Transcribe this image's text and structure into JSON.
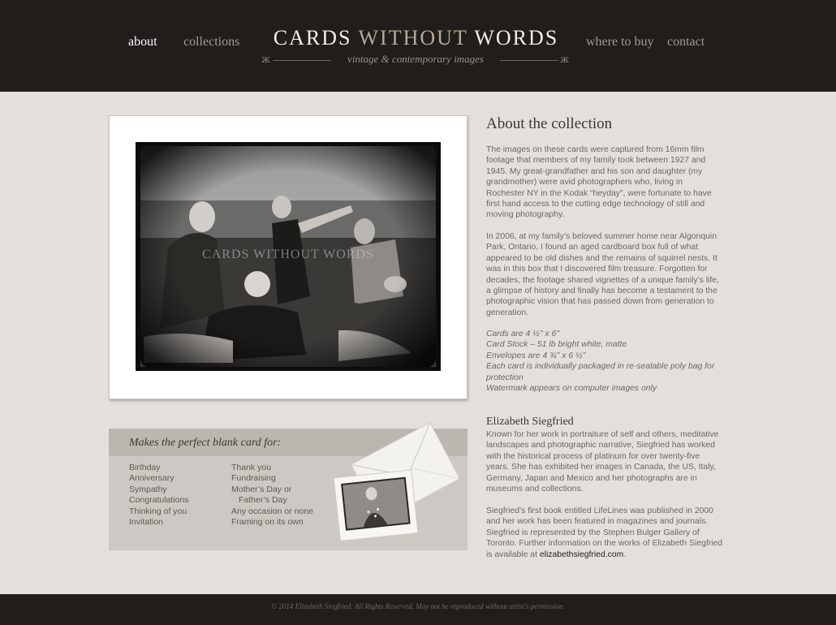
{
  "nav": {
    "about": "about",
    "collections": "collections",
    "where_to_buy": "where to buy",
    "contact": "contact"
  },
  "logo": {
    "title_part1": "CARDS ",
    "title_part2": "WITHOUT",
    "title_part3": " WORDS",
    "tagline": "vintage & contemporary images"
  },
  "photo": {
    "watermark": "CARDS WITHOUT WORDS"
  },
  "cards_box": {
    "title": "Makes the perfect blank card for:",
    "col1": [
      "Birthday",
      "Anniversary",
      "Sympathy",
      "Congratulations",
      "Thinking of you",
      "Invitation"
    ],
    "col2": [
      "Thank you",
      "Fundraising",
      "Mother’s Day or",
      "   Father’s Day",
      "Any occasion or none",
      "Framing on its own"
    ]
  },
  "about": {
    "heading": "About the collection",
    "para1": "The images on these cards were captured from 16mm film footage that members of my family took between 1927 and 1945. My great-grandfather and his son and daughter (my grandmother) were avid photographers who, living in Rochester NY in the Kodak “heyday”, were fortunate to have first hand access to the cutting edge technology of still and moving photography.",
    "para2": "In 2006, at my family’s beloved summer home near Algonquin Park, Ontario, I found an aged cardboard box full of what appeared to be old dishes and the remains of squirrel nests. It was in this box that I discovered film treasure. Forgotten for decades, the footage shared vignettes of a unique family’s life, a glimpse of history and finally has become a testament to the photographic vision that has passed down from generation to generation.",
    "specs": [
      "Cards are 4 ½\" x 6\"",
      "Card Stock – 51 lb bright white, matte",
      "Envelopes are 4 ¾\" x 6 ½\"",
      "Each card is individually packaged in re-sealable poly bag for protection",
      "Watermark appears on computer images only"
    ]
  },
  "artist": {
    "name": "Elizabeth Siegfried",
    "para1": "Known for her work in portraiture of self and others, meditative landscapes and photographic narrative, Siegfried has worked with the historical process of platinum for over twenty-five years. She has exhibited her images in Canada, the US, Italy, Germany, Japan and Mexico and her photographs are in museums and collections.",
    "para2": "Siegfried’s first book entitled LifeLines was published in 2000 and her work has been featured in magazines and journals. Siegfried is represented by the Stephen Bulger Gallery of Toronto. Further information on the works of Elizabeth Siegfried is available at ",
    "link": "elizabethsiegfried.com",
    "para2_end": "."
  },
  "footer": {
    "copyright": "© 2014 Elizabeth Siegfried. All Rights Reserved. May not be reproduced without artist’s permission."
  }
}
